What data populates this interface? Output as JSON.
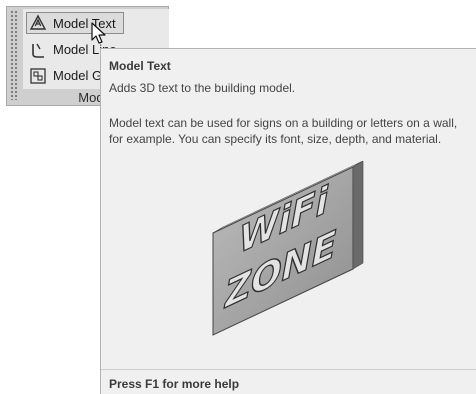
{
  "panel": {
    "label": "Model",
    "tools": [
      {
        "label": "Model Text",
        "icon": "model-text-icon"
      },
      {
        "label": "Model Line",
        "icon": "model-line-icon"
      },
      {
        "label": "Model Group",
        "icon": "model-group-icon"
      }
    ]
  },
  "tooltip": {
    "title": "Model Text",
    "short": "Adds 3D text to the building model.",
    "long_line1": "Model text can be used for signs on a building or letters on a wall,",
    "long_line2": "for example. You can specify its font, size, depth, and material.",
    "image_line1": "WiFi",
    "image_line2": "ZONE",
    "footer": "Press F1 for more help"
  }
}
